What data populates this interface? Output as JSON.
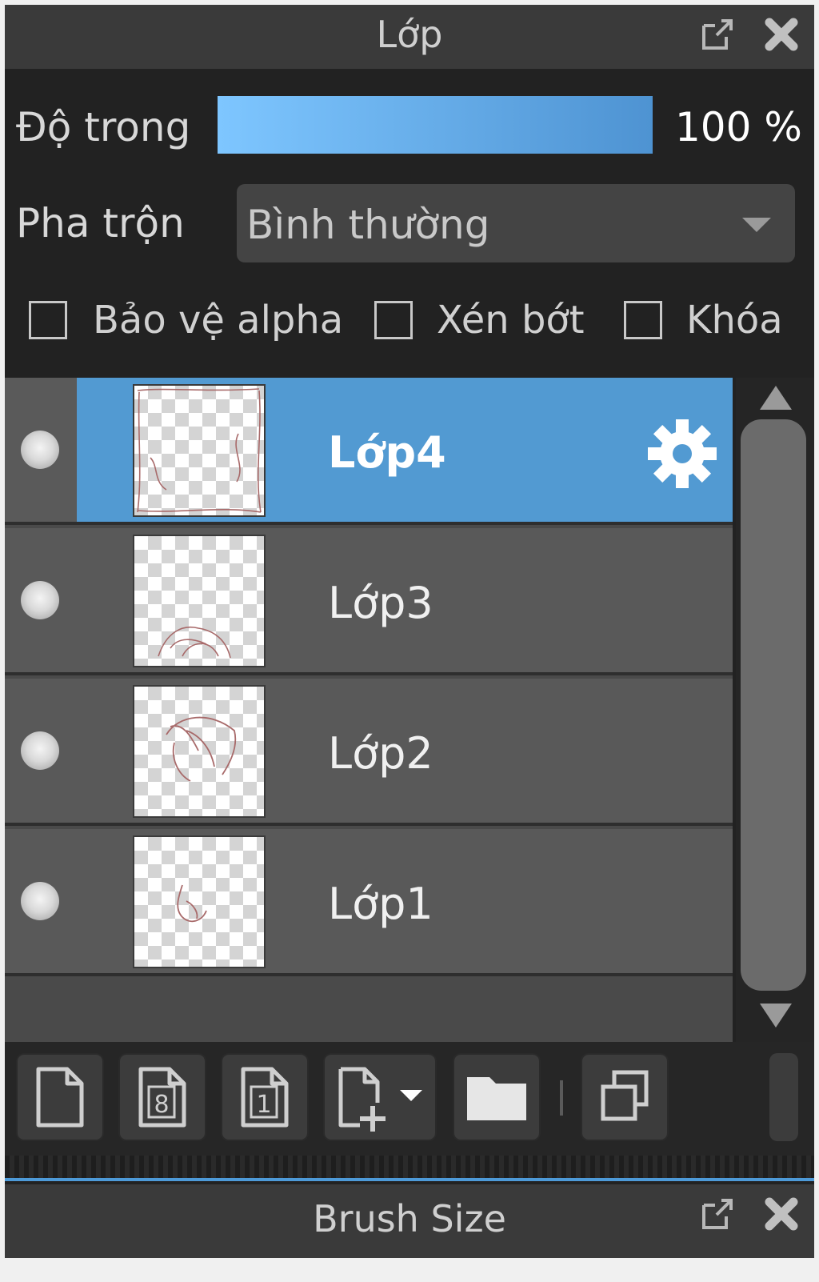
{
  "layer_panel": {
    "title": "Lớp",
    "opacity": {
      "label": "Độ trong",
      "value_text": "100 %",
      "value": 1.0
    },
    "blend": {
      "label": "Pha trộn",
      "selected": "Bình thường"
    },
    "options": {
      "protect_alpha": "Bảo vệ alpha",
      "clip": "Xén bớt",
      "lock": "Khóa"
    },
    "layers": [
      {
        "name": "Lớp4",
        "selected": true
      },
      {
        "name": "Lớp3",
        "selected": false
      },
      {
        "name": "Lớp2",
        "selected": false
      },
      {
        "name": "Lớp1",
        "selected": false
      }
    ],
    "toolbar": {
      "icons": [
        "new-layer-icon",
        "new-8bit-layer-icon",
        "new-1bit-layer-icon",
        "add-layer-menu-icon",
        "new-folder-icon",
        "duplicate-layer-icon"
      ],
      "bit8_label": "8",
      "bit1_label": "1"
    }
  },
  "brush_panel": {
    "title": "Brush Size"
  },
  "colors": {
    "accent": "#529ad2",
    "panel_bg": "#222222",
    "row_bg": "#595959"
  }
}
